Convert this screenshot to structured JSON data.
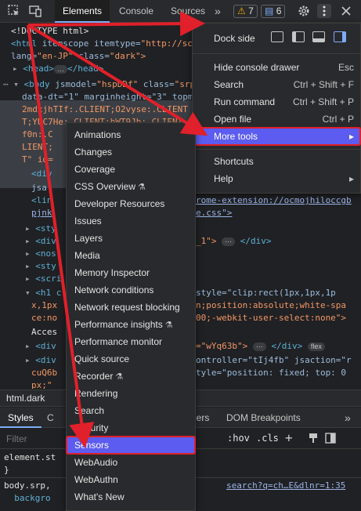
{
  "toolbar": {
    "tabs": [
      "Elements",
      "Console",
      "Sources"
    ],
    "more_tabs": "»",
    "warnings_count": "7",
    "messages_count": "6"
  },
  "dom": {
    "lines": {
      "l1": "<!DOCTYPE html>",
      "l2a": "<html ",
      "l2b": "itemscope itemtype=",
      "l2c": "\"http://sc",
      "l3a": "lang=",
      "l3b": "\"en-JP\"",
      "l3c": " class=",
      "l3d": "\"dark\">",
      "l4a": "▸ ",
      "l4b": "<head>",
      "l4c": "…",
      "l4d": "</head>",
      "l5a": "⋯ ▾ ",
      "l5b": "<body ",
      "l5c": "jsmodel=",
      "l5d": "\"hspDDf\"",
      "l5e": " class=",
      "l5f": "\"srp",
      "l6": "data-dt=\"1\" marginheight=\"3\" topm",
      "l7": "2mdxjhTIf:.CLIENT;O2vyse:.CLIENT",
      "l8": "T;YUC7He:.CLIENT;hWT9Jb:.CLIENT",
      "l9": "f0n:.C",
      "l10": "LIENT;",
      "l11": "T\" id=",
      "l12a": "<div",
      "l13": "jsa",
      "l14a": "<lin",
      "l14b": "rome-extension://ocmojhiloccgb",
      "l15a": "pjnk",
      "l15b": "e.css\">",
      "l16a": "<sty",
      "l17a": "<div",
      "l17b": "_1\">",
      "l17c": "</div>",
      "l18a": "<nos",
      "l19a": "<sty",
      "l20a": "<scri",
      "l21a": "<h1 c",
      "l21b": "style=\"clip:rect(1px,1px,1p",
      "l22a": "x,1px",
      "l22b": "n;position:absolute;white-spa",
      "l23a": "ce:no",
      "l23b": "00;-webkit-user-select:none\">",
      "l24": "Acces",
      "l25a": "<div",
      "l25b": "=\"wYq63b\">",
      "l25c": "</div>",
      "l26a": "<div",
      "l26b": "ontroller=\"tIj4fb\" jsaction=\"r",
      "l27a": "cuQ6b",
      "l27b": "tyle=\"position: fixed; top: 0",
      "l28a": "px;\""
    },
    "pill_ellipsis": "⋯",
    "pill_flex": "flex"
  },
  "breadcrumb": "html.dark",
  "bottom_tabs": [
    "Styles",
    "C",
    "ners",
    "DOM Breakpoints"
  ],
  "filter": {
    "placeholder": "Filter",
    "hov": ":hov",
    "cls": ".cls"
  },
  "styles": {
    "s1": "element.st",
    "s2": "}",
    "s3a": "body.srp,",
    "s3b": "search?q=ch…E&dlnr=1:35",
    "s4a": "  backgro"
  },
  "main_menu": {
    "dock_side": "Dock side",
    "items": [
      {
        "label": "Hide console drawer",
        "shortcut": "Esc"
      },
      {
        "label": "Search",
        "shortcut": "Ctrl + Shift + F"
      },
      {
        "label": "Run command",
        "shortcut": "Ctrl + Shift + P"
      },
      {
        "label": "Open file",
        "shortcut": "Ctrl + P"
      },
      {
        "label": "More tools",
        "shortcut": "▸"
      },
      {
        "label": "Shortcuts",
        "shortcut": ""
      },
      {
        "label": "Help",
        "shortcut": "▸"
      }
    ]
  },
  "more_tools_menu": {
    "items": [
      {
        "label": "Animations",
        "flask": ""
      },
      {
        "label": "Changes",
        "flask": ""
      },
      {
        "label": "Coverage",
        "flask": ""
      },
      {
        "label": "CSS Overview",
        "flask": "⚗"
      },
      {
        "label": "Developer Resources",
        "flask": ""
      },
      {
        "label": "Issues",
        "flask": ""
      },
      {
        "label": "Layers",
        "flask": ""
      },
      {
        "label": "Media",
        "flask": ""
      },
      {
        "label": "Memory Inspector",
        "flask": ""
      },
      {
        "label": "Network conditions",
        "flask": ""
      },
      {
        "label": "Network request blocking",
        "flask": ""
      },
      {
        "label": "Performance insights",
        "flask": "⚗"
      },
      {
        "label": "Performance monitor",
        "flask": ""
      },
      {
        "label": "Quick source",
        "flask": ""
      },
      {
        "label": "Recorder",
        "flask": "⚗"
      },
      {
        "label": "Rendering",
        "flask": ""
      },
      {
        "label": "Search",
        "flask": ""
      },
      {
        "label": "Security",
        "flask": ""
      },
      {
        "label": "Sensors",
        "flask": ""
      },
      {
        "label": "WebAudio",
        "flask": ""
      },
      {
        "label": "WebAuthn",
        "flask": ""
      },
      {
        "label": "What's New",
        "flask": ""
      }
    ]
  },
  "colors": {
    "highlight": "#5c5cf0",
    "annotation_red": "#e0202a",
    "accent": "#7cacf8"
  }
}
